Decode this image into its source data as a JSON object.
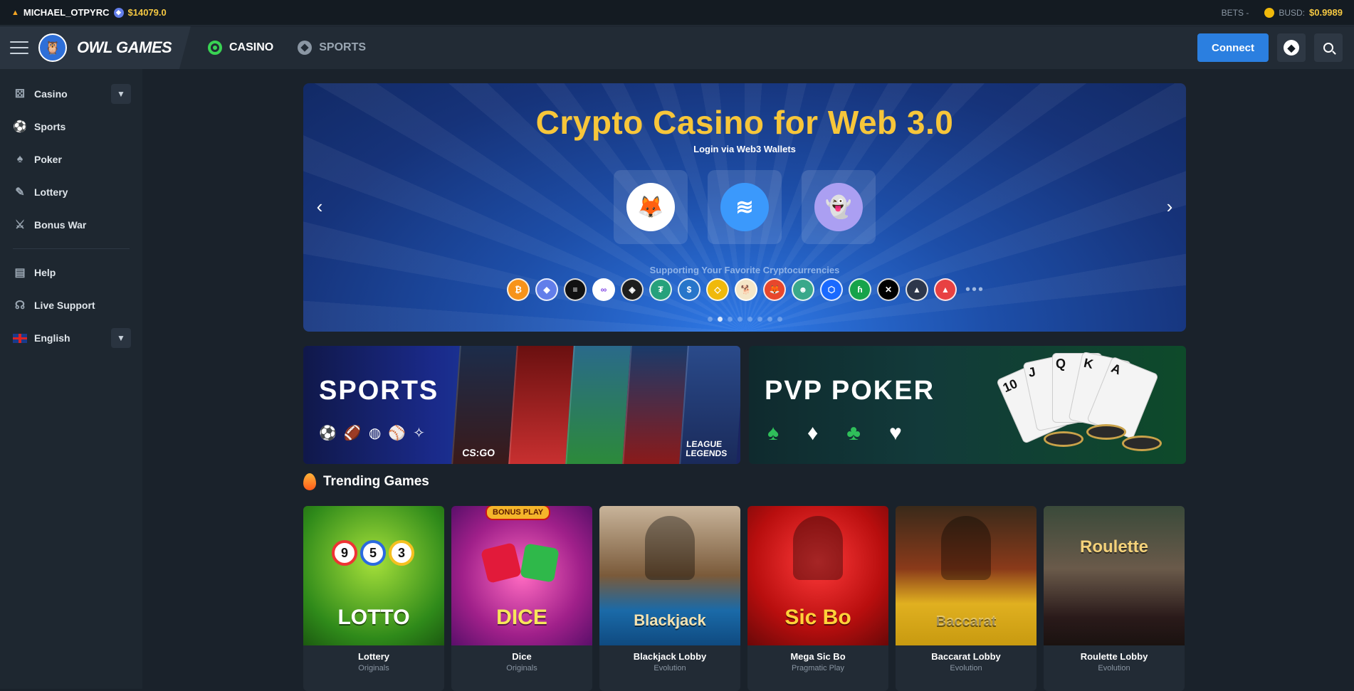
{
  "topbar": {
    "username": "MICHAEL_OTPYRC",
    "balance": "$14079.0",
    "bets_label": "BETS -",
    "busd_label": "BUSD:",
    "busd_value": "$0.9989"
  },
  "header": {
    "brand": "OWL GAMES",
    "tabs": [
      {
        "label": "CASINO",
        "active": true
      },
      {
        "label": "SPORTS",
        "active": false
      }
    ],
    "connect_label": "Connect"
  },
  "sidebar": {
    "items": [
      {
        "label": "Casino",
        "icon": "dice-icon",
        "expandable": true
      },
      {
        "label": "Sports",
        "icon": "sports-ball-icon"
      },
      {
        "label": "Poker",
        "icon": "cards-icon"
      },
      {
        "label": "Lottery",
        "icon": "ticket-icon"
      },
      {
        "label": "Bonus War",
        "icon": "crossed-swords-icon"
      }
    ],
    "secondary": [
      {
        "label": "Help",
        "icon": "book-icon"
      },
      {
        "label": "Live Support",
        "icon": "headset-icon"
      },
      {
        "label": "English",
        "icon": "uk-flag-icon",
        "expandable": true
      }
    ]
  },
  "hero": {
    "title": "Crypto Casino for Web 3.0",
    "subtitle": "Login via Web3 Wallets",
    "wallets": [
      "metamask-icon",
      "walletconnect-icon",
      "phantom-icon"
    ],
    "support_text": "Supporting Your Favorite Cryptocurrencies",
    "coins": [
      {
        "name": "bitcoin",
        "glyph": "₿",
        "color": "#f7931a"
      },
      {
        "name": "ethereum",
        "glyph": "◆",
        "color": "#627eea"
      },
      {
        "name": "solana",
        "glyph": "≡",
        "color": "#111111"
      },
      {
        "name": "polygon",
        "glyph": "∞",
        "color": "#ffffff"
      },
      {
        "name": "bnb",
        "glyph": "◈",
        "color": "#1e1e1e"
      },
      {
        "name": "tether",
        "glyph": "₮",
        "color": "#26a17b"
      },
      {
        "name": "usdc",
        "glyph": "$",
        "color": "#2775ca"
      },
      {
        "name": "busd",
        "glyph": "◇",
        "color": "#f0b90b"
      },
      {
        "name": "polydoge",
        "glyph": "🐕",
        "color": "#f4e6c8"
      },
      {
        "name": "shiba",
        "glyph": "🦊",
        "color": "#e8472c"
      },
      {
        "name": "pepe",
        "glyph": "☻",
        "color": "#3aa88a"
      },
      {
        "name": "fantom",
        "glyph": "⬡",
        "color": "#1969ff"
      },
      {
        "name": "harmony",
        "glyph": "ɦ",
        "color": "#16a34a"
      },
      {
        "name": "okb",
        "glyph": "✕",
        "color": "#000000"
      },
      {
        "name": "arbitrum",
        "glyph": "▲",
        "color": "#2d374b"
      },
      {
        "name": "avalanche",
        "glyph": "▲",
        "color": "#e84142"
      }
    ],
    "slide_count": 8,
    "active_slide": 2
  },
  "promos": [
    {
      "title": "SPORTS",
      "panels": [
        "CS:GO",
        "",
        "",
        "",
        "LEAGUE LEGENDS"
      ]
    },
    {
      "title": "PVP POKER"
    }
  ],
  "trending": {
    "title": "Trending Games",
    "games": [
      {
        "name": "Lottery",
        "art": "LOTTO",
        "sub": "Originals"
      },
      {
        "name": "Dice",
        "art": "DICE",
        "badge": "BONUS PLAY",
        "sub": "Originals"
      },
      {
        "name": "Blackjack Lobby",
        "art": "Blackjack",
        "sub": "Evolution"
      },
      {
        "name": "Mega Sic Bo",
        "art": "Sic Bo",
        "sub": "Pragmatic Play"
      },
      {
        "name": "Baccarat Lobby",
        "art": "Baccarat",
        "sub": "Evolution"
      },
      {
        "name": "Roulette Lobby",
        "art": "Roulette",
        "sub": "Evolution"
      }
    ]
  },
  "colors": {
    "accent": "#2b7fe0",
    "brand_green": "#39d353",
    "gold": "#f7c63a",
    "background": "#1a222b",
    "sidebar": "#1e2730"
  }
}
